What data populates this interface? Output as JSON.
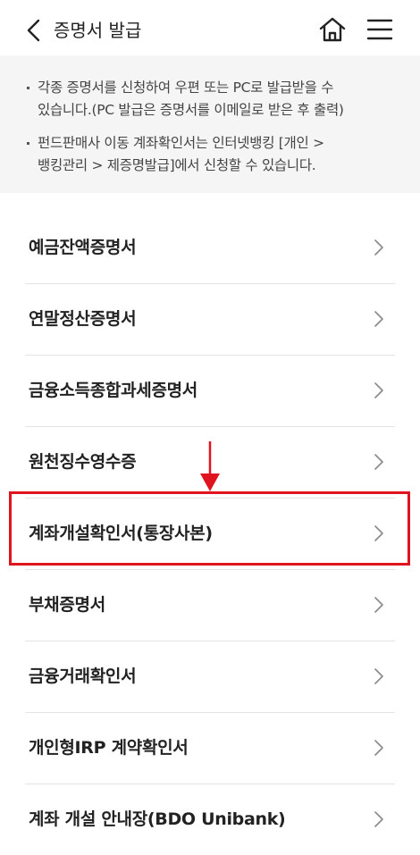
{
  "header": {
    "title": "증명서 발급"
  },
  "notice": {
    "items": [
      {
        "lines": [
          "각종 증명서를 신청하여 우편 또는 PC로 발급받을 수",
          "있습니다.(PC 발급은 증명서를 이메일로 받은 후 출력)"
        ]
      },
      {
        "lines": [
          "펀드판매사 이동 계좌확인서는 인터넷뱅킹 [개인 >",
          "뱅킹관리 > 제증명발급]에서 신청할 수 있습니다."
        ]
      }
    ]
  },
  "list": [
    {
      "label": "예금잔액증명서"
    },
    {
      "label": "연말정산증명서"
    },
    {
      "label": "금융소득종합과세증명서"
    },
    {
      "label": "원천징수영수증"
    },
    {
      "label": "계좌개설확인서(통장사본)"
    },
    {
      "label": "부채증명서"
    },
    {
      "label": "금융거래확인서"
    },
    {
      "label": "개인형IRP 계약확인서"
    },
    {
      "label": "계좌 개설 안내장(BDO Unibank)"
    }
  ],
  "colors": {
    "highlight": "#e0141e",
    "notice_bg": "#f5f5f5",
    "divider": "#e4e4e4"
  },
  "icons": {
    "back": "chevron-left-icon",
    "home": "home-icon",
    "menu": "hamburger-menu-icon",
    "item": "chevron-right-icon"
  }
}
